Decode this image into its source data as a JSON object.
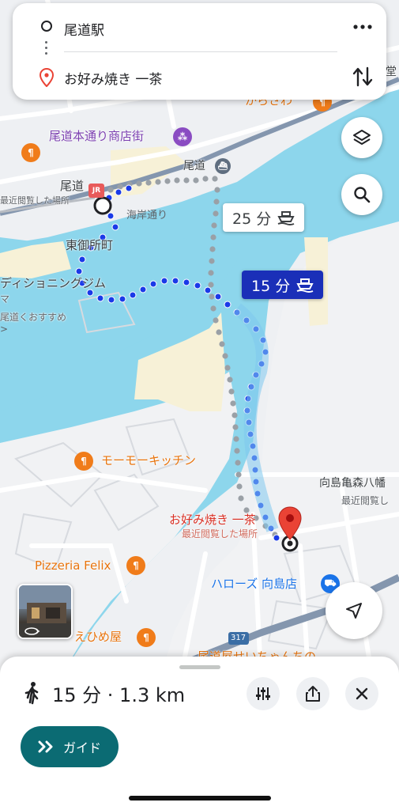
{
  "route": {
    "origin": "尾道駅",
    "destination": "お好み焼き 一茶"
  },
  "map": {
    "places": {
      "shopping_street": "尾道本通り商店街",
      "onomichi_station": "尾道",
      "onomichi_area": "尾道",
      "recently_viewed_1": "最近閲覧した場所",
      "kaigan_dori": "海岸通り",
      "higashi_gosho": "東御所町",
      "gym": "ディショニングジム",
      "gym_line2": "マ",
      "recommend": "尾道くおすすめ",
      "karasawa": "からさわ",
      "top_right": "堂",
      "moomoo": "モーモーキッチン",
      "mukaishima": "向島亀森八幡",
      "recently_viewed_3": "最近閲覧し",
      "dest_name": "お好み焼き 一茶",
      "dest_sub": "最近閲覧した場所",
      "pizzeria": "Pizzeria Felix",
      "harrows": "ハローズ 向島店",
      "ehimeya": "えひめ屋",
      "route_shield": "317",
      "bottom_cut": "尾道屋せいちゃんちの"
    },
    "ferry_badge_alt": "25 分",
    "ferry_badge_main": "15 分",
    "colors": {
      "water": "#8dd6ec",
      "route_blue": "#1a3ae8",
      "route_gray": "#9aa0a6",
      "badge_navy": "#1a2fb8",
      "pin_red": "#ea4335"
    }
  },
  "sheet": {
    "summary": "15 分 · 1.3 km",
    "guide_label": "ガイド",
    "icons": [
      "walk-icon",
      "tune-icon",
      "share-icon",
      "close-icon"
    ]
  }
}
